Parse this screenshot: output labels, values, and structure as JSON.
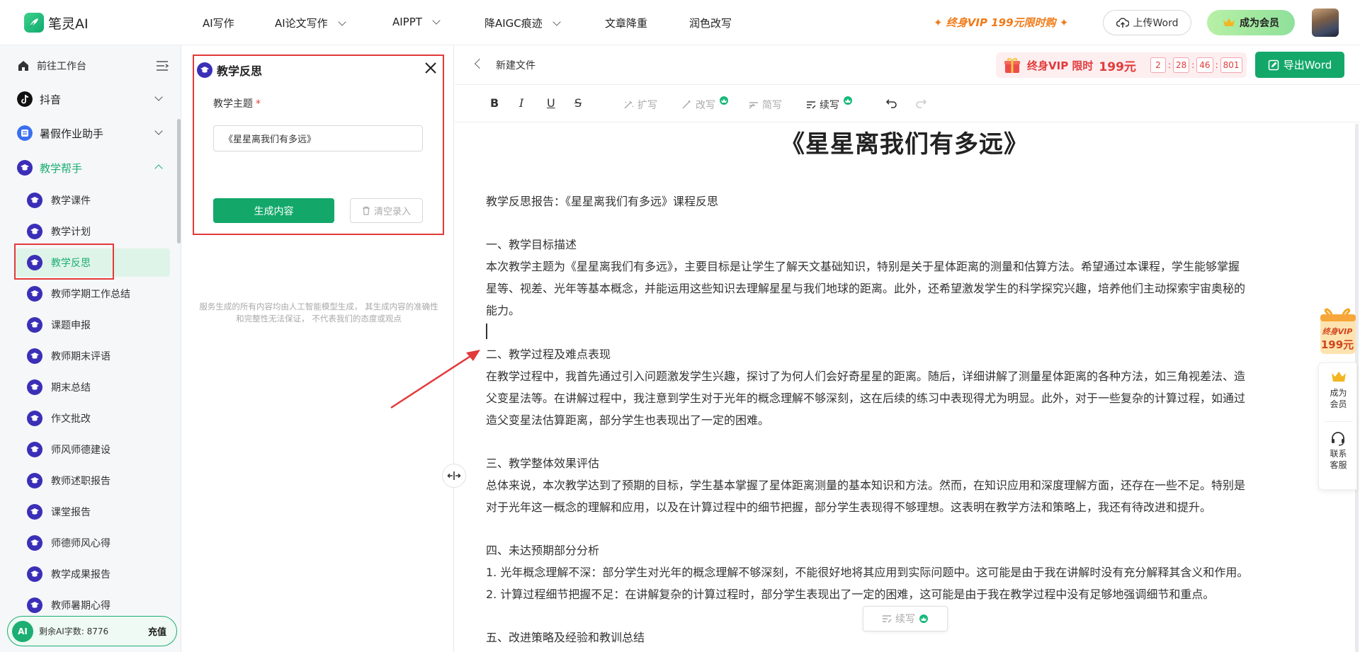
{
  "topnav": {
    "logo_text": "笔灵AI",
    "items": [
      {
        "label": "AI写作"
      },
      {
        "label": "AI论文写作"
      },
      {
        "label": "AIPPT"
      },
      {
        "label": "降AIGC痕迹"
      },
      {
        "label": "文章降重"
      },
      {
        "label": "润色改写"
      }
    ],
    "promo": "终身VIP 199元限时购",
    "upload_label": "上传Word",
    "member_label": "成为会员"
  },
  "sidebar": {
    "workspace_label": "前往工作台",
    "sections": [
      {
        "label": "抖音"
      },
      {
        "label": "暑假作业助手"
      },
      {
        "label": "教学帮手"
      }
    ],
    "items": [
      {
        "label": "教学课件"
      },
      {
        "label": "教学计划"
      },
      {
        "label": "教学反思"
      },
      {
        "label": "教师学期工作总结"
      },
      {
        "label": "课题申报"
      },
      {
        "label": "教师期末评语"
      },
      {
        "label": "期末总结"
      },
      {
        "label": "作文批改"
      },
      {
        "label": "师风师德建设"
      },
      {
        "label": "教师述职报告"
      },
      {
        "label": "课堂报告"
      },
      {
        "label": "师德师风心得"
      },
      {
        "label": "教学成果报告"
      },
      {
        "label": "教师暑期心得"
      }
    ],
    "credits_badge": "AI",
    "credits_label": "剩余AI字数: 8776",
    "recharge_label": "充值"
  },
  "form": {
    "title": "教学反思",
    "field_label": "教学主题",
    "required_mark": "*",
    "topic_value": "《星星离我们有多远》",
    "generate_label": "生成内容",
    "clear_label": "清空录入",
    "disclaimer": "服务生成的所有内容均由人工智能模型生成， 其生成内容的准确性和完整性无法保证， 不代表我们的态度或观点"
  },
  "editor": {
    "filename": "新建文件",
    "vip_banner": {
      "text": "终身VIP 限时",
      "price": "199元",
      "countdown": [
        "2",
        "28",
        "46",
        "801"
      ]
    },
    "export_label": "导出Word",
    "toolbar": {
      "bold": "B",
      "italic": "I",
      "underline": "U",
      "strike": "S",
      "expand": "扩写",
      "rewrite": "改写",
      "shorten": "简写",
      "continue": "续写"
    },
    "doc_title": "《星星离我们有多远》",
    "paragraphs": [
      "教学反思报告：《星星离我们有多远》课程反思",
      "一、教学目标描述",
      "本次教学主题为《星星离我们有多远》，主要目标是让学生了解天文基础知识，特别是关于星体距离的测量和估算方法。希望通过本课程，学生能够掌握",
      "星等、视差、光年等基本概念，并能运用这些知识去理解星星与我们地球的距离。此外，还希望激发学生的科学探究兴趣，培养他们主动探索宇宙奥秘的",
      "能力。",
      "二、教学过程及难点表现",
      "在教学过程中，我首先通过引入问题激发学生兴趣，探讨了为何人们会好奇星星的距离。随后，详细讲解了测量星体距离的各种方法，如三角视差法、造",
      "父变星法等。在讲解过程中，我注意到学生对于光年的概念理解不够深刻，这在后续的练习中表现得尤为明显。此外，对于一些复杂的计算过程，如通过",
      "造父变星法估算距离，部分学生也表现出了一定的困难。",
      "三、教学整体效果评估",
      "总体来说，本次教学达到了预期的目标，学生基本掌握了星体距离测量的基本知识和方法。然而，在知识应用和深度理解方面，还存在一些不足。特别是",
      "对于光年这一概念的理解和应用，以及在计算过程中的细节把握，部分学生表现得不够理想。这表明在教学方法和策略上，我还有待改进和提升。",
      "四、未达预期部分分析",
      "1. 光年概念理解不深：部分学生对光年的概念理解不够深刻，不能很好地将其应用到实际问题中。这可能是由于我在讲解时没有充分解释其含义和作用。",
      "2. 计算过程细节把握不足：在讲解复杂的计算过程时，部分学生表现出了一定的困难，这可能是由于我在教学过程中没有足够地强调细节和重点。",
      "五、改进策略及经验和教训总结"
    ],
    "float_write_label": "续写"
  },
  "right_float": {
    "vip_line1": "终身VIP",
    "vip_line2": "199元",
    "member_label": "成为会员",
    "service_label": "联系客服"
  },
  "colors": {
    "accent_green": "#13a86a",
    "highlight_red": "#e23a3a",
    "promo_orange": "#f17a18",
    "sidebar_active_bg": "#dff4e8",
    "teach_icon": "#3b2fb8"
  },
  "icons": {
    "logo": "quill-logo-icon",
    "upload": "cloud-upload-icon",
    "member": "crown-icon",
    "workspace": "home-icon",
    "menu": "list-menu-icon",
    "teach": "graduation-cap-icon",
    "close": "close-icon",
    "trash": "trash-icon",
    "export": "edit-doc-icon",
    "gift": "gift-icon",
    "service": "headset-icon"
  }
}
